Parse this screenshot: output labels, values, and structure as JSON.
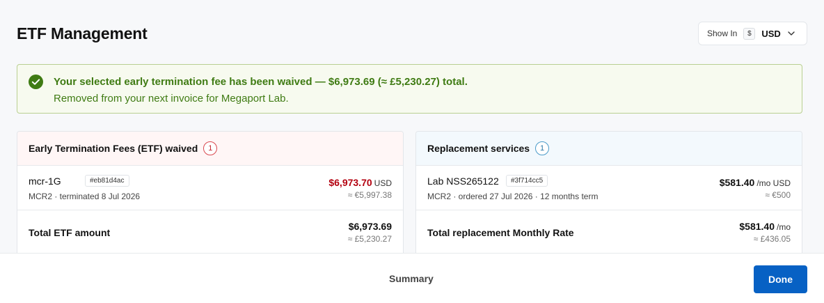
{
  "page": {
    "title": "ETF Management"
  },
  "currency_selector": {
    "label": "Show In",
    "symbol": "$",
    "value": "USD"
  },
  "alert": {
    "headline": "Your selected early termination fee has been waived — $6,973.69 (≈ £5,230.27) total.",
    "detail": "Removed from your next invoice for Megaport Lab.",
    "color": "#3f7b13"
  },
  "etf_panel": {
    "title": "Early Termination Fees (ETF) waived",
    "count": "1",
    "items": [
      {
        "name": "mcr-1G",
        "id": "#eb81d4ac",
        "sub": "MCR2 · terminated 8 Jul 2026",
        "amount": "$6,973.70",
        "unit": "USD",
        "converted": "≈ €5,997.38"
      }
    ],
    "total": {
      "label": "Total ETF amount",
      "amount": "$6,973.69",
      "converted": "≈ £5,230.27"
    }
  },
  "replacement_panel": {
    "title": "Replacement services",
    "count": "1",
    "items": [
      {
        "name": "Lab NSS265122",
        "id": "#3f714cc5",
        "sub": "MCR2 · ordered 27 Jul 2026 · 12 months term",
        "amount": "$581.40",
        "unit": "/mo USD",
        "converted": "≈ €500"
      }
    ],
    "total": {
      "label": "Total replacement Monthly Rate",
      "amount": "$581.40",
      "unit": "/mo",
      "converted": "≈ £436.05"
    }
  },
  "footer": {
    "summary_label": "Summary",
    "done_label": "Done"
  },
  "colors": {
    "accent": "#0761c4",
    "etf_amount": "#b3000f",
    "success": "#3f7b13"
  }
}
